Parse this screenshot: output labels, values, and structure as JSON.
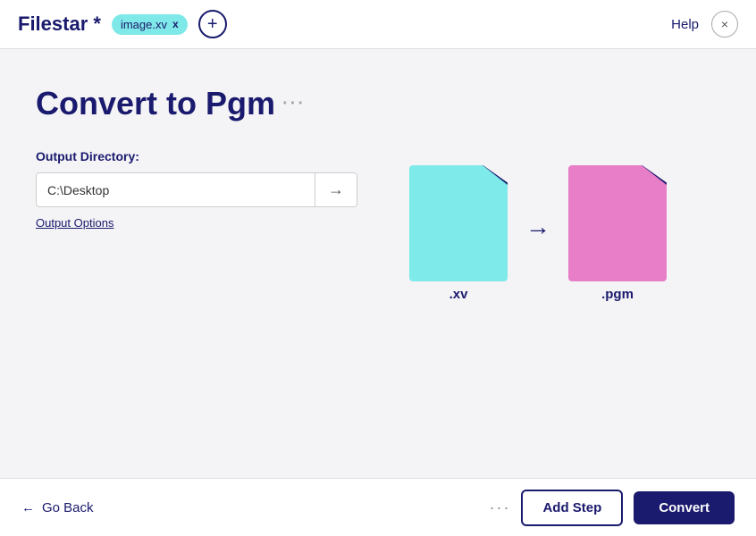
{
  "header": {
    "app_title": "Filestar *",
    "file_tag": "image.xv",
    "help_label": "Help",
    "close_label": "×"
  },
  "main": {
    "page_title": "Convert to Pgm",
    "title_dots": "···",
    "output_label": "Output Directory:",
    "directory_value": "C:\\Desktop",
    "directory_placeholder": "C:\\Desktop",
    "output_options_label": "Output Options",
    "source_ext": ".xv",
    "target_ext": ".pgm"
  },
  "footer": {
    "go_back_label": "Go Back",
    "more_dots": "···",
    "add_step_label": "Add Step",
    "convert_label": "Convert"
  }
}
